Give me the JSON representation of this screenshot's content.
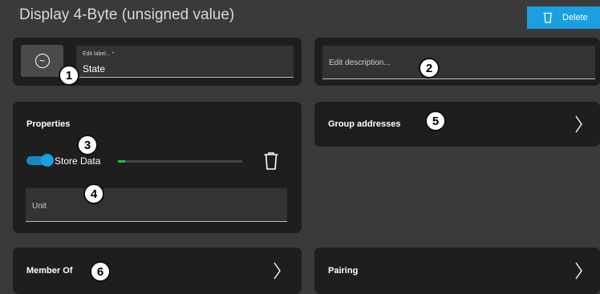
{
  "header": {
    "title": "Display 4-Byte (unsigned value)",
    "delete_label": "Delete"
  },
  "label_card": {
    "icon": "sine-wave-icon",
    "label_hint": "Edit label... *",
    "label_value": "State"
  },
  "desc_card": {
    "placeholder": "Edit description..."
  },
  "properties": {
    "title": "Properties",
    "store_data_label": "Store Data",
    "store_data_enabled": true,
    "store_progress": 0.06,
    "unit_placeholder": "Unit"
  },
  "group_addresses": {
    "label": "Group addresses"
  },
  "member_of": {
    "label": "Member Of"
  },
  "pairing": {
    "label": "Pairing"
  },
  "badges": [
    "1",
    "2",
    "3",
    "4",
    "5",
    "6"
  ],
  "colors": {
    "background": "#3a3a3a",
    "card": "#1e1e1e",
    "accent": "#1a9fe0",
    "progress": "#19c24a"
  }
}
